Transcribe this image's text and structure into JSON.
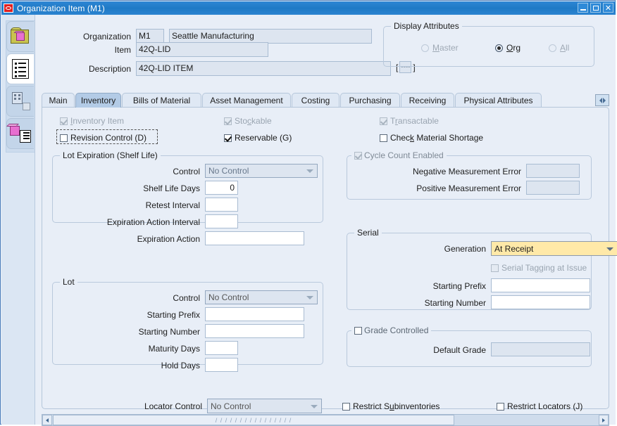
{
  "window": {
    "title": "Organization Item (M1)",
    "app_icon": "oracle-logo-icon",
    "minimize_label": "",
    "maximize_label": "",
    "close_label": "✕"
  },
  "sidebar": {
    "items": [
      {
        "name": "folder-cube-icon",
        "label": ""
      },
      {
        "name": "document-list-icon",
        "label": ""
      },
      {
        "name": "organization-building-icon",
        "label": ""
      },
      {
        "name": "item-catalog-icon",
        "label": ""
      }
    ]
  },
  "header": {
    "organization_label": "Organization",
    "organization_code": "M1",
    "organization_name": "Seattle Manufacturing",
    "item_label": "Item",
    "item_value": "42Q-LID",
    "description_label": "Description",
    "description_value": "42Q-LID ITEM",
    "lov_bracket_open": "[",
    "lov_bracket_close": "]",
    "lov_glyph": "----"
  },
  "display_attributes": {
    "title": "Display Attributes",
    "options": [
      {
        "label": "Master",
        "accel": "M",
        "selected": false,
        "enabled": false
      },
      {
        "label": "Org",
        "accel": "O",
        "selected": true,
        "enabled": true
      },
      {
        "label": "All",
        "accel": "A",
        "selected": false,
        "enabled": false
      }
    ]
  },
  "tabs": {
    "items": [
      {
        "label": "Main",
        "active": false
      },
      {
        "label": "Inventory",
        "active": true
      },
      {
        "label": "Bills of Material",
        "active": false
      },
      {
        "label": "Asset Management",
        "active": false
      },
      {
        "label": "Costing",
        "active": false
      },
      {
        "label": "Purchasing",
        "active": false
      },
      {
        "label": "Receiving",
        "active": false
      },
      {
        "label": "Physical Attributes",
        "active": false
      }
    ],
    "nav_button_name": "tab-scroll-button"
  },
  "inventory": {
    "checkboxes": [
      {
        "label": "Inventory Item",
        "checked": true,
        "enabled": false,
        "accel": "I"
      },
      {
        "label": "Stockable",
        "checked": true,
        "enabled": false,
        "accel": "c"
      },
      {
        "label": "Transactable",
        "checked": true,
        "enabled": false,
        "accel": "r"
      },
      {
        "label": "Revision Control (D)",
        "checked": false,
        "enabled": true,
        "focused": true
      },
      {
        "label": "Reservable (G)",
        "checked": true,
        "enabled": true
      },
      {
        "label": "Check Material Shortage",
        "checked": false,
        "enabled": true,
        "accel": "k"
      }
    ],
    "lot_expiration": {
      "title": "Lot Expiration (Shelf Life)",
      "fields": [
        {
          "label": "Control",
          "type": "combo",
          "value": "No Control",
          "enabled": false
        },
        {
          "label": "Shelf Life Days",
          "type": "text",
          "value": "0"
        },
        {
          "label": "Retest Interval",
          "type": "text",
          "value": ""
        },
        {
          "label": "Expiration Action Interval",
          "type": "text",
          "value": ""
        },
        {
          "label": "Expiration Action",
          "type": "text",
          "value": ""
        }
      ]
    },
    "lot": {
      "title": "Lot",
      "fields": [
        {
          "label": "Control",
          "type": "combo",
          "value": "No Control",
          "enabled": false
        },
        {
          "label": "Starting Prefix",
          "type": "text",
          "value": ""
        },
        {
          "label": "Starting Number",
          "type": "text",
          "value": ""
        },
        {
          "label": "Maturity Days",
          "type": "text",
          "value": ""
        },
        {
          "label": "Hold Days",
          "type": "text",
          "value": ""
        }
      ]
    },
    "cycle_count": {
      "title": "Cycle Count Enabled",
      "checked": true,
      "enabled": false,
      "fields": [
        {
          "label": "Negative Measurement Error",
          "value": ""
        },
        {
          "label": "Positive Measurement Error",
          "value": ""
        }
      ]
    },
    "serial": {
      "title": "Serial",
      "generation_label": "Generation",
      "generation_value": "At Receipt",
      "generation_highlighted": true,
      "tagging_label": "Serial Tagging at Issue",
      "tagging_checked": false,
      "tagging_enabled": false,
      "starting_prefix_label": "Starting Prefix",
      "starting_prefix_value": "",
      "starting_number_label": "Starting Number",
      "starting_number_value": ""
    },
    "grade": {
      "title": "Grade Controlled",
      "checked": false,
      "default_grade_label": "Default Grade",
      "default_grade_value": ""
    },
    "bottom": {
      "locator_control_label": "Locator Control",
      "locator_control_value": "No Control",
      "restrict_subinventories_label": "Restrict Subinventories",
      "restrict_subinventories_accel": "u",
      "restrict_subinventories_checked": false,
      "restrict_locators_label": "Restrict Locators (J)",
      "restrict_locators_checked": false
    }
  },
  "scrollbar": {
    "left_arrow": "◀",
    "right_arrow": "▶",
    "grip": "/ / / / / / / / / / / / / / / /"
  }
}
